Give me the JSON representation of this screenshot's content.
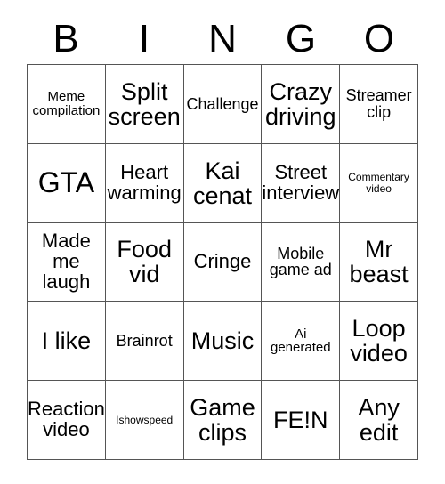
{
  "card": {
    "header_letters": [
      "B",
      "I",
      "N",
      "G",
      "O"
    ],
    "columns": 5,
    "rows": 5,
    "border_color": "#555555",
    "background_color": "#ffffff",
    "text_color": "#000000",
    "cells": [
      [
        {
          "text": "Meme compilation",
          "size": "fs-sm"
        },
        {
          "text": "Split screen",
          "size": "fs-xl"
        },
        {
          "text": "Challenge",
          "size": "fs-md"
        },
        {
          "text": "Crazy driving",
          "size": "fs-xl"
        },
        {
          "text": "Streamer clip",
          "size": "fs-md"
        }
      ],
      [
        {
          "text": "GTA",
          "size": "fs-xxl"
        },
        {
          "text": "Heart warming",
          "size": "fs-lg"
        },
        {
          "text": "Kai cenat",
          "size": "fs-xl"
        },
        {
          "text": "Street interview",
          "size": "fs-lg"
        },
        {
          "text": "Commentary video",
          "size": "fs-xs"
        }
      ],
      [
        {
          "text": "Made me laugh",
          "size": "fs-lg"
        },
        {
          "text": "Food vid",
          "size": "fs-xl"
        },
        {
          "text": "Cringe",
          "size": "fs-lg"
        },
        {
          "text": "Mobile game ad",
          "size": "fs-md"
        },
        {
          "text": "Mr beast",
          "size": "fs-xl"
        }
      ],
      [
        {
          "text": "I like",
          "size": "fs-xl"
        },
        {
          "text": "Brainrot",
          "size": "fs-md"
        },
        {
          "text": "Music",
          "size": "fs-xl"
        },
        {
          "text": "Ai generated",
          "size": "fs-sm"
        },
        {
          "text": "Loop video",
          "size": "fs-xl"
        }
      ],
      [
        {
          "text": "Reaction video",
          "size": "fs-lg"
        },
        {
          "text": "Ishowspeed",
          "size": "fs-xs"
        },
        {
          "text": "Game clips",
          "size": "fs-xl"
        },
        {
          "text": "FE!N",
          "size": "fs-xl"
        },
        {
          "text": "Any edit",
          "size": "fs-xl"
        }
      ]
    ]
  }
}
